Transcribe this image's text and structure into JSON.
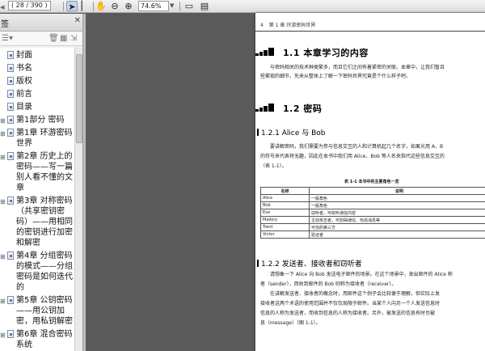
{
  "toolbar": {
    "page_counter": "( 28 / 390 )",
    "zoom": "74.6%"
  },
  "sidebar": {
    "title": "签",
    "items": [
      {
        "label": "封面",
        "expandable": false
      },
      {
        "label": "书名",
        "expandable": false
      },
      {
        "label": "版权",
        "expandable": false
      },
      {
        "label": "前言",
        "expandable": false
      },
      {
        "label": "目录",
        "expandable": false
      },
      {
        "label": "第1部分 密码",
        "expandable": true
      },
      {
        "label": "第1章 环游密码世界",
        "expandable": true
      },
      {
        "label": "第2章 历史上的密码——写一篇别人看不懂的文章",
        "expandable": true
      },
      {
        "label": "第3章 对称密码（共享密钥密码）——用相同的密钥进行加密和解密",
        "expandable": true
      },
      {
        "label": "第4章 分组密码的模式——分组密码是如何迭代的",
        "expandable": true
      },
      {
        "label": "第5章 公钥密码——用公钥加密，用私钥解密",
        "expandable": true
      },
      {
        "label": "第6章 混合密码系统",
        "expandable": true
      }
    ]
  },
  "page": {
    "header_num": "4",
    "header_text": "第 1 章  环游密码世界",
    "sec_1_1": "1.1  本章学习的内容",
    "p1_1": "与密码相关的技术种类繁多，而且它们之间有着紧密的关联。本章中，让我们暂且",
    "p1_2": "些繁琐的细节，先来从整体上了解一下密码世界究竟是个什么样子吧。",
    "sec_1_2": "1.2  密码",
    "sec_1_2_1": "1.2.1  Alice 与 Bob",
    "p2_1": "要讲解密码，我们需要为参与信息交互的人和计算机起几个名字，如果光用 A、B",
    "p2_2": "的符号来代表将无趣，因此在本书中我们用 Alice、Bob 等人名来指代这些信息交互的",
    "p2_3": "（表 1-1）。",
    "table_caption": "表 1-1  本书中的主要角色一览",
    "table_headers": [
      "名称",
      "说明"
    ],
    "table_rows": [
      [
        "Alice",
        "一般角色"
      ],
      [
        "Bob",
        "一般角色"
      ],
      [
        "Eve",
        "窃听者，可收听通信内容"
      ],
      [
        "Mallory",
        "主动攻击者，可妨碍通信、伪造消息等"
      ],
      [
        "Trent",
        "可信的第三方"
      ],
      [
        "Victor",
        "验证者"
      ]
    ],
    "sec_1_2_2": "1.2.2  发送者、接收者和窃听者",
    "p3_1": "请想象一下 Alice 向 Bob 发送电子邮件的场景。在这个场景中，发出邮件的 Alice 称",
    "p3_2": "者（sender），而收到邮件的 Bob 则称为接收者（receiver）。",
    "p3_3": "在讲解发送者、接收者的概念时，用邮件这个例子会比较便于理解，但实际上发",
    "p3_4": "接收者这两个术语的使用范围并不仅仅局限于邮件。当某个人向另一个人发送信息时",
    "p3_5": "信息的人称为发送者，而收到信息的人称为接收者。另外，被发送的信息有时也被",
    "p3_6": "息（message）（图 1-1）。"
  }
}
